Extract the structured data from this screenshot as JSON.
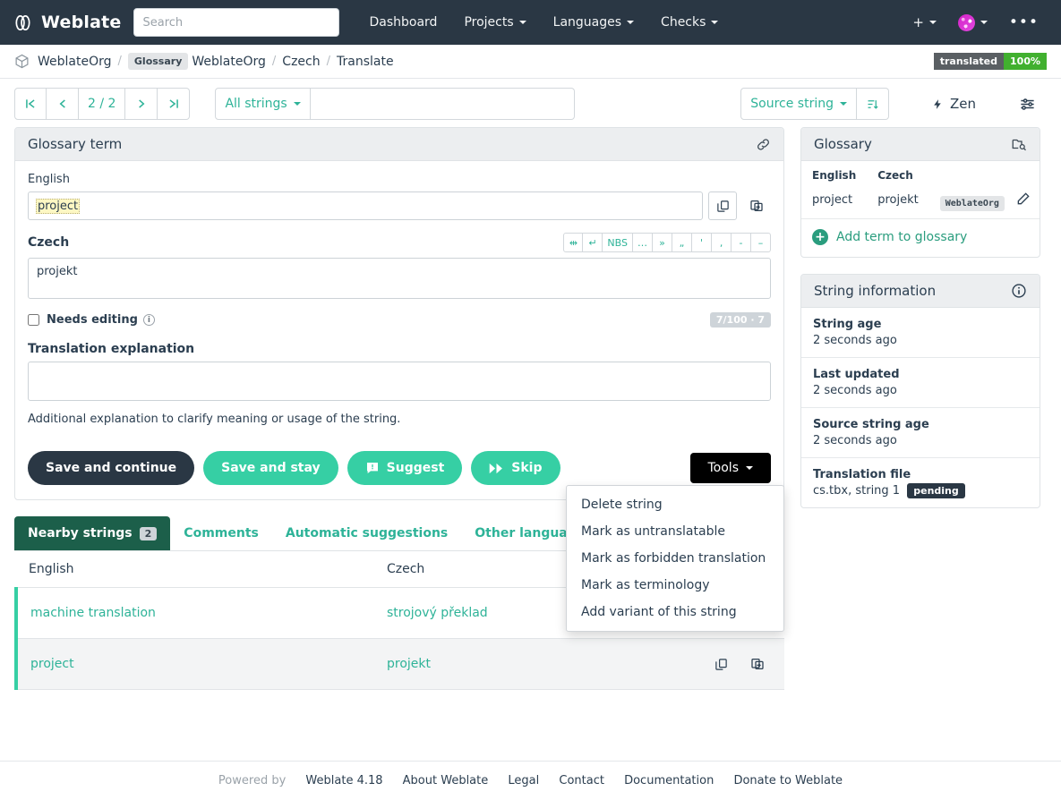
{
  "navbar": {
    "brand": "Weblate",
    "search_placeholder": "Search",
    "links": [
      {
        "label": "Dashboard",
        "caret": false
      },
      {
        "label": "Projects",
        "caret": true
      },
      {
        "label": "Languages",
        "caret": true
      },
      {
        "label": "Checks",
        "caret": true
      }
    ],
    "add_label": "+",
    "more_label": "•••"
  },
  "breadcrumb": {
    "project": "WeblateOrg",
    "glossary_badge": "Glossary",
    "component": "WeblateOrg",
    "language": "Czech",
    "page": "Translate",
    "separator": "/",
    "status_label": "translated",
    "status_percent": "100%"
  },
  "toolbar": {
    "first_label": "|<",
    "prev_label": "<",
    "position": "2 / 2",
    "next_label": ">",
    "last_label": ">|",
    "filter_label": "All strings",
    "search_value": "",
    "search_placeholder": "",
    "sort_label": "Source string",
    "sort_icon": "sort-icon",
    "zen_label": "Zen",
    "settings_icon": "sliders-icon"
  },
  "editor": {
    "card_title": "Glossary term",
    "permalink_icon": "link-icon",
    "source_label": "English",
    "source_text": "project",
    "copy_icon": "copy-icon",
    "clone_icon": "clone-icon",
    "target_label": "Czech",
    "target_text": "projekt",
    "edit_tools": [
      "⇹",
      "↵",
      "NBS",
      "…",
      "»",
      "„",
      "'",
      "‚",
      "-",
      "–"
    ],
    "needs_editing_label": "Needs editing",
    "needs_editing_checked": false,
    "char_count": "7/100 · 7",
    "explanation_label": "Translation explanation",
    "explanation_value": "",
    "explanation_help": "Additional explanation to clarify meaning or usage of the string.",
    "buttons": {
      "save_continue": "Save and continue",
      "save_stay": "Save and stay",
      "suggest": "Suggest",
      "skip": "Skip",
      "tools": "Tools"
    },
    "tools_menu": [
      "Delete string",
      "Mark as untranslatable",
      "Mark as forbidden translation",
      "Mark as terminology",
      "Add variant of this string"
    ]
  },
  "tabs": [
    {
      "label": "Nearby strings",
      "badge": "2",
      "active": true
    },
    {
      "label": "Comments",
      "badge": "",
      "active": false
    },
    {
      "label": "Automatic suggestions",
      "badge": "",
      "active": false
    },
    {
      "label": "Other languages",
      "badge": "",
      "active": false
    }
  ],
  "nearby": {
    "headers": [
      "English",
      "Czech",
      ""
    ],
    "rows": [
      {
        "english": "machine translation",
        "czech": "strojový překlad",
        "current": false
      },
      {
        "english": "project",
        "czech": "projekt",
        "current": true
      }
    ]
  },
  "glossary": {
    "title": "Glossary",
    "head_icon": "folder-search-icon",
    "headers": [
      "English",
      "Czech"
    ],
    "terms": [
      {
        "english": "project",
        "czech": "projekt",
        "badge": "WeblateOrg",
        "edit_icon": "pencil-icon"
      }
    ],
    "add_label": "Add term to glossary",
    "add_icon": "plus-circle-icon"
  },
  "string_information": {
    "title": "String information",
    "head_icon": "info-icon",
    "items": [
      {
        "title": "String age",
        "value": "2 seconds ago",
        "badge": ""
      },
      {
        "title": "Last updated",
        "value": "2 seconds ago",
        "badge": ""
      },
      {
        "title": "Source string age",
        "value": "2 seconds ago",
        "badge": ""
      },
      {
        "title": "Translation file",
        "value": "cs.tbx, string 1",
        "badge": "pending"
      }
    ]
  },
  "footer": {
    "powered_by": "Powered by",
    "version": "Weblate 4.18",
    "links": [
      "About Weblate",
      "Legal",
      "Contact",
      "Documentation",
      "Donate to Weblate"
    ]
  },
  "colors": {
    "navbar": "#2a3744",
    "accent_teal": "#36cfa4",
    "link_green": "#2eb398",
    "tab_active": "#1c5f4a",
    "status_green": "#41b02f"
  }
}
